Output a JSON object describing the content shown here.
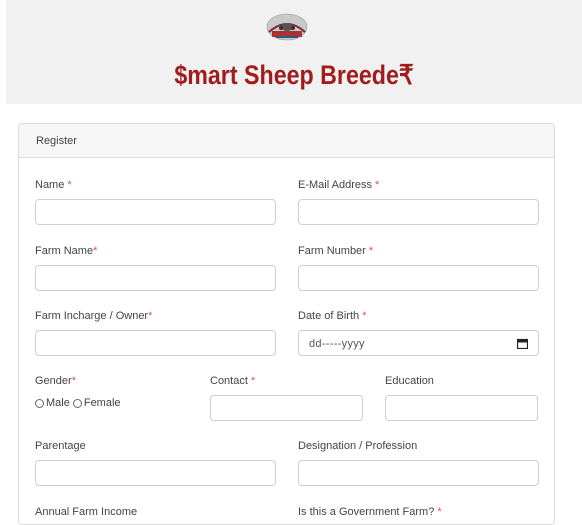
{
  "header": {
    "logo_icon": "sheep-emblem-icon",
    "brand_title": "$mart Sheep Breede₹"
  },
  "card": {
    "title": "Register"
  },
  "form": {
    "name": {
      "label": "Name",
      "required": "*",
      "value": ""
    },
    "email": {
      "label": "E-Mail Address",
      "required": "*",
      "value": ""
    },
    "farm_name": {
      "label": "Farm Name",
      "required": "*",
      "value": ""
    },
    "farm_number": {
      "label": "Farm Number",
      "required": "*",
      "value": ""
    },
    "farm_incharge": {
      "label": "Farm Incharge / Owner",
      "required": "*",
      "value": ""
    },
    "dob": {
      "label": "Date of Birth",
      "required": "*",
      "placeholder": "dd-----yyyy"
    },
    "gender": {
      "label": "Gender",
      "required": "*",
      "options": [
        "Male",
        "Female"
      ]
    },
    "contact": {
      "label": "Contact",
      "required": "*",
      "value": ""
    },
    "education": {
      "label": "Education",
      "value": ""
    },
    "parentage": {
      "label": "Parentage",
      "value": ""
    },
    "designation": {
      "label": "Designation / Profession",
      "value": ""
    },
    "annual_income": {
      "label": "Annual Farm Income"
    },
    "government_farm": {
      "label": "Is this a Government Farm?",
      "required": "*"
    }
  },
  "colors": {
    "brand": "#a11d1d",
    "required": "#d9534f"
  }
}
